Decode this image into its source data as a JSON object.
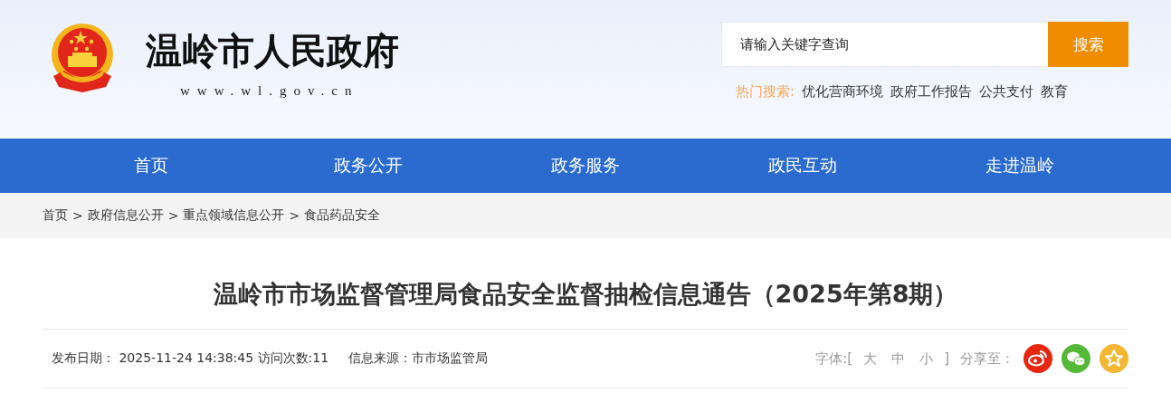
{
  "header": {
    "site_title": "温岭市人民政府",
    "site_url": "www.wl.gov.cn"
  },
  "search": {
    "placeholder": "请输入关键字查询",
    "button": "搜索",
    "hot_label": "热门搜索:",
    "hot_links": [
      "优化营商环境",
      "政府工作报告",
      "公共支付",
      "教育"
    ]
  },
  "nav": {
    "items": [
      "首页",
      "政务公开",
      "政务服务",
      "政民互动",
      "走进温岭"
    ]
  },
  "breadcrumb": {
    "separator": ">",
    "items": [
      "首页",
      "政府信息公开",
      "重点领域信息公开",
      "食品药品安全"
    ]
  },
  "article": {
    "title": "温岭市市场监督管理局食品安全监督抽检信息通告（2025年第8期）",
    "meta": [
      "发布日期： 2025-11-24 14:38:45 访问次数:11",
      "信息来源：市市场监管局"
    ],
    "font_label": "字体:[",
    "font_sizes": [
      "大",
      "中",
      "小"
    ],
    "font_close": "]",
    "share_label": "分享至：",
    "share": [
      {
        "kind": "weibo",
        "color": "#e6260f"
      },
      {
        "kind": "wechat",
        "color": "#55b837"
      },
      {
        "kind": "favorite",
        "color": "#f5b731"
      }
    ]
  }
}
